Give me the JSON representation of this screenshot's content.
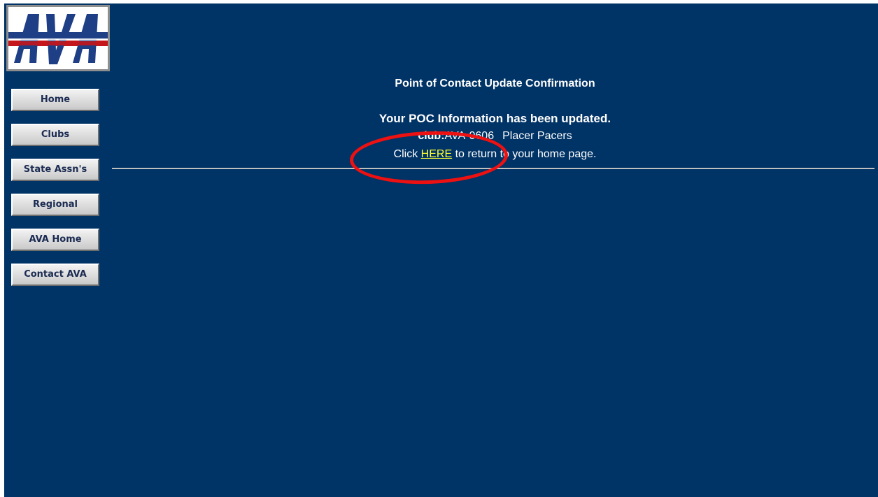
{
  "logo": {
    "text": "AVA"
  },
  "nav": {
    "items": [
      {
        "label": "Home"
      },
      {
        "label": "Clubs"
      },
      {
        "label": "State Assn's"
      },
      {
        "label": "Regional"
      },
      {
        "label": "AVA Home"
      },
      {
        "label": "Contact AVA"
      }
    ]
  },
  "content": {
    "title": "Point of Contact Update Confirmation",
    "confirmation": "Your POC Information has been updated.",
    "club_label": "club:",
    "club_id": "AVA-0606",
    "club_name": "Placer Pacers",
    "return_prefix": "Click",
    "return_link": "HERE",
    "return_suffix": "to return to your home page."
  },
  "colors": {
    "page_background": "#003366",
    "link": "#ffff33",
    "annotation": "#ee1111"
  }
}
